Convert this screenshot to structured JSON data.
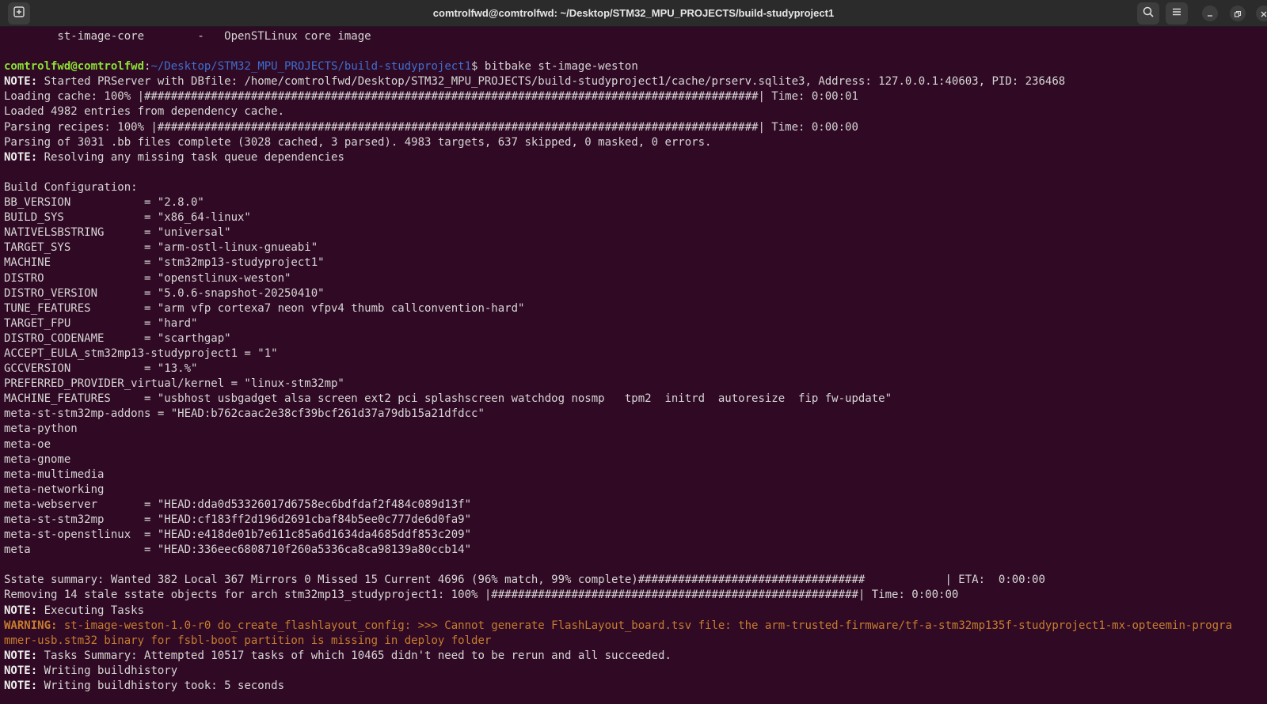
{
  "window": {
    "title": "comtrolfwd@comtrolfwd: ~/Desktop/STM32_MPU_PROJECTS/build-studyproject1"
  },
  "icons": {
    "new_tab": "new-tab-icon",
    "search": "search-icon",
    "menu": "hamburger-menu-icon",
    "minimize": "minimize-icon",
    "maximize": "maximize-icon",
    "close": "close-icon"
  },
  "colors": {
    "background": "#300a24",
    "prompt_user": "#8ae234",
    "prompt_path": "#3d6fd1",
    "warning": "#c67c2e"
  },
  "terminal": {
    "lines": [
      {
        "text": "        st-image-core        -   OpenSTLinux core image"
      },
      {
        "text": ""
      },
      {
        "type": "prompt",
        "user": "comtrolfwd@comtrolfwd",
        "sep": ":",
        "path": "~/Desktop/STM32_MPU_PROJECTS/build-studyproject1",
        "cmd": "$ bitbake st-image-weston"
      },
      {
        "label": "NOTE:",
        "text": " Started PRServer with DBfile: /home/comtrolfwd/Desktop/STM32_MPU_PROJECTS/build-studyproject1/cache/prserv.sqlite3, Address: 127.0.0.1:40603, PID: 236468"
      },
      {
        "text": "Loading cache: 100% |############################################################################################| Time: 0:00:01"
      },
      {
        "text": "Loaded 4982 entries from dependency cache."
      },
      {
        "text": "Parsing recipes: 100% |##########################################################################################| Time: 0:00:00"
      },
      {
        "text": "Parsing of 3031 .bb files complete (3028 cached, 3 parsed). 4983 targets, 637 skipped, 0 masked, 0 errors."
      },
      {
        "label": "NOTE:",
        "text": " Resolving any missing task queue dependencies"
      },
      {
        "text": ""
      },
      {
        "text": "Build Configuration:"
      },
      {
        "text": "BB_VERSION           = \"2.8.0\""
      },
      {
        "text": "BUILD_SYS            = \"x86_64-linux\""
      },
      {
        "text": "NATIVELSBSTRING      = \"universal\""
      },
      {
        "text": "TARGET_SYS           = \"arm-ostl-linux-gnueabi\""
      },
      {
        "text": "MACHINE              = \"stm32mp13-studyproject1\""
      },
      {
        "text": "DISTRO               = \"openstlinux-weston\""
      },
      {
        "text": "DISTRO_VERSION       = \"5.0.6-snapshot-20250410\""
      },
      {
        "text": "TUNE_FEATURES        = \"arm vfp cortexa7 neon vfpv4 thumb callconvention-hard\""
      },
      {
        "text": "TARGET_FPU           = \"hard\""
      },
      {
        "text": "DISTRO_CODENAME      = \"scarthgap\""
      },
      {
        "text": "ACCEPT_EULA_stm32mp13-studyproject1 = \"1\""
      },
      {
        "text": "GCCVERSION           = \"13.%\""
      },
      {
        "text": "PREFERRED_PROVIDER_virtual/kernel = \"linux-stm32mp\""
      },
      {
        "text": "MACHINE_FEATURES     = \"usbhost usbgadget alsa screen ext2 pci splashscreen watchdog nosmp   tpm2  initrd  autoresize  fip fw-update\""
      },
      {
        "text": "meta-st-stm32mp-addons = \"HEAD:b762caac2e38cf39bcf261d37a79db15a21dfdcc\""
      },
      {
        "text": "meta-python"
      },
      {
        "text": "meta-oe"
      },
      {
        "text": "meta-gnome"
      },
      {
        "text": "meta-multimedia"
      },
      {
        "text": "meta-networking"
      },
      {
        "text": "meta-webserver       = \"HEAD:dda0d53326017d6758ec6bdfdaf2f484c089d13f\""
      },
      {
        "text": "meta-st-stm32mp      = \"HEAD:cf183ff2d196d2691cbaf84b5ee0c777de6d0fa9\""
      },
      {
        "text": "meta-st-openstlinux  = \"HEAD:e418de01b7e611c85a6d1634da4685ddf853c209\""
      },
      {
        "text": "meta                 = \"HEAD:336eec6808710f260a5336ca8ca98139a80ccb14\""
      },
      {
        "text": ""
      },
      {
        "text": "Sstate summary: Wanted 382 Local 367 Mirrors 0 Missed 15 Current 4696 (96% match, 99% complete)##################################            | ETA:  0:00:00"
      },
      {
        "text": "Removing 14 stale sstate objects for arch stm32mp13_studyproject1: 100% |#######################################################| Time: 0:00:00"
      },
      {
        "label": "NOTE:",
        "text": " Executing Tasks"
      },
      {
        "type": "warning",
        "label": "WARNING:",
        "text": " st-image-weston-1.0-r0 do_create_flashlayout_config: >>> Cannot generate FlashLayout_board.tsv file: the arm-trusted-firmware/tf-a-stm32mp135f-studyproject1-mx-opteemin-progra"
      },
      {
        "type": "warning",
        "text": "mmer-usb.stm32 binary for fsbl-boot partition is missing in deploy folder"
      },
      {
        "label": "NOTE:",
        "text": " Tasks Summary: Attempted 10517 tasks of which 10465 didn't need to be rerun and all succeeded."
      },
      {
        "label": "NOTE:",
        "text": " Writing buildhistory"
      },
      {
        "label": "NOTE:",
        "text": " Writing buildhistory took: 5 seconds"
      }
    ]
  }
}
